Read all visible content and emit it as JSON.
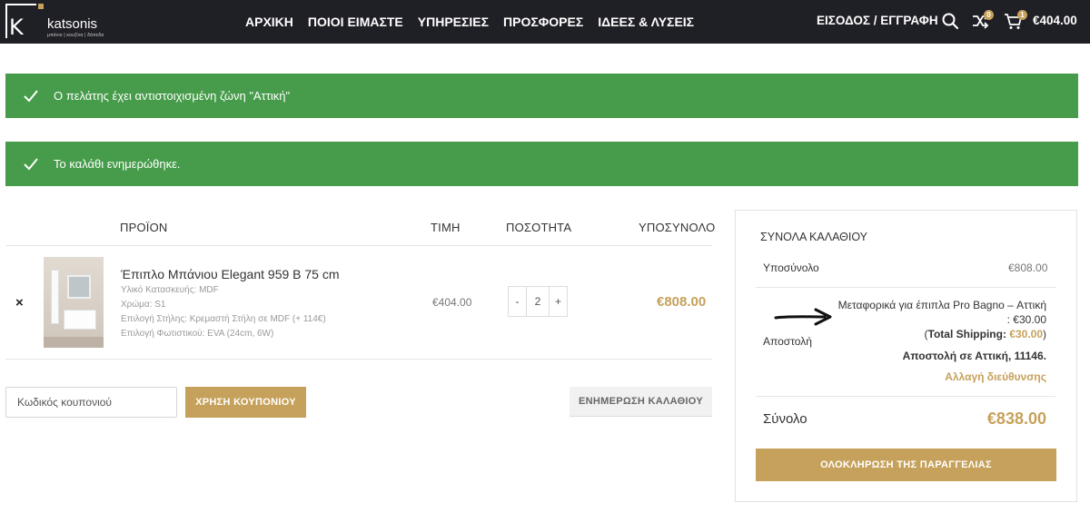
{
  "header": {
    "logo": {
      "name": "katsonis",
      "tagline": "μπάνιο | κουζίνα | δάπεδα"
    },
    "nav": [
      "ΑΡΧΙΚΗ",
      "ΠΟΙΟΙ ΕΙΜΑΣΤΕ",
      "ΥΠΗΡΕΣΙΕΣ",
      "ΠΡΟΣΦΟΡΕΣ",
      "ΙΔΕΕΣ & ΛΥΣΕΙΣ"
    ],
    "login": "ΕΙΣΟΔΟΣ / ΕΓΓΡΑΦΗ",
    "compare_count": "0",
    "cart_count": "1",
    "cart_total": "€404.00",
    "icons": [
      "search-icon",
      "compare-icon",
      "cart-icon"
    ]
  },
  "notices": [
    "Ο πελάτης έχει αντιστοιχισμένη ζώνη \"Αττική\"",
    "Το καλάθι ενημερώθηκε."
  ],
  "cart": {
    "columns": {
      "product": "ΠΡΟΪΟΝ",
      "price": "ΤΙΜΗ",
      "quantity": "ΠΟΣΟΤΗΤΑ",
      "subtotal": "ΥΠΟΣΥΝΟΛΟ"
    },
    "item": {
      "remove": "×",
      "name": "Έπιπλο Μπάνιου Elegant 959 B 75 cm",
      "meta": [
        "Υλικό Κατασκευής: MDF",
        "Χρώμα: S1",
        "Επιλογή Στήλης: Κρεμαστή Στήλη σε MDF (+ 114€)",
        "Επιλογή Φωτιστικού: EVA (24cm, 6W)"
      ],
      "price": "€404.00",
      "qty_minus": "-",
      "qty": "2",
      "qty_plus": "+",
      "subtotal": "€808.00"
    },
    "coupon_placeholder": "Κωδικός κουπονιού",
    "apply_coupon": "ΧΡΗΣΗ ΚΟΥΠΟΝΙΟΥ",
    "update_cart": "ΕΝΗΜΕΡΩΣΗ ΚΑΛΑΘΙΟΥ"
  },
  "totals": {
    "title": "ΣΥΝΟΛΑ ΚΑΛΑΘΙΟΥ",
    "subtotal_label": "Υποσύνολο",
    "subtotal_value": "€808.00",
    "shipping_label": "Αποστολή",
    "shipping_method_line1": "Μεταφορικά για έπιπλα Pro Bagno – Αττική",
    "shipping_method_line2": ": €30.00",
    "total_shipping_open": "(",
    "total_shipping_label": "Total Shipping:",
    "total_shipping_value": "€30.00",
    "total_shipping_close": ")",
    "shipping_to": "Αποστολή σε Αττική, 11146.",
    "change_address": "Αλλαγή διεύθυνσης",
    "total_label": "Σύνολο",
    "total_value": "€838.00",
    "checkout": "ΟΛΟΚΛΗΡΩΣΗ ΤΗΣ ΠΑΡΑΓΓΕΛΙΑΣ"
  },
  "colors": {
    "header_bg": "#1f1f26",
    "accent": "#c6a15b",
    "success": "#469c4a"
  }
}
